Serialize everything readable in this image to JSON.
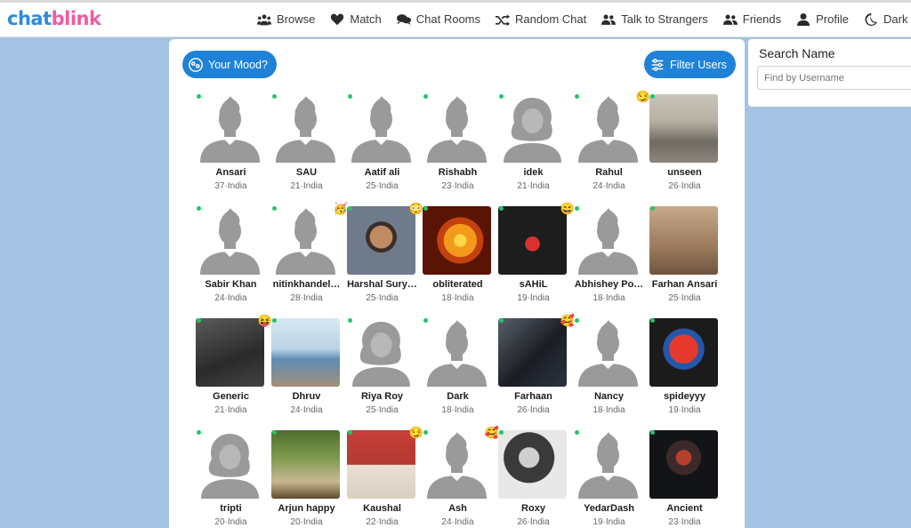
{
  "brand": {
    "part1": "chat",
    "part2": "blink"
  },
  "nav": [
    {
      "label": "Browse",
      "icon": "users-icon"
    },
    {
      "label": "Match",
      "icon": "heart-icon"
    },
    {
      "label": "Chat Rooms",
      "icon": "chat-bubbles-icon"
    },
    {
      "label": "Random Chat",
      "icon": "shuffle-icon"
    },
    {
      "label": "Talk to Strangers",
      "icon": "user-group-icon"
    },
    {
      "label": "Friends",
      "icon": "friends-icon"
    },
    {
      "label": "Profile",
      "icon": "user-icon"
    },
    {
      "label": "Dark",
      "icon": "moon-icon"
    }
  ],
  "toolbar": {
    "mood_label": "Your Mood?",
    "filter_label": "Filter Users"
  },
  "search": {
    "title": "Search Name",
    "placeholder": "Find by Username"
  },
  "colors": {
    "accent": "#1f82d8",
    "brand_blue": "#2d8be0",
    "brand_pink": "#f25aa3",
    "online": "#21c76a",
    "background": "#a5c4e4"
  },
  "users": [
    {
      "name": "Ansari",
      "meta": "37·India",
      "avatar": "male",
      "online": true,
      "emoji": ""
    },
    {
      "name": "SAU",
      "meta": "21·India",
      "avatar": "male",
      "online": true,
      "emoji": ""
    },
    {
      "name": "Aatif ali",
      "meta": "25·India",
      "avatar": "male",
      "online": true,
      "emoji": ""
    },
    {
      "name": "Rishabh",
      "meta": "23·India",
      "avatar": "male",
      "online": true,
      "emoji": ""
    },
    {
      "name": "idek",
      "meta": "21·India",
      "avatar": "female",
      "online": true,
      "emoji": ""
    },
    {
      "name": "Rahul",
      "meta": "24·India",
      "avatar": "male",
      "online": true,
      "emoji": "😏"
    },
    {
      "name": "unseen",
      "meta": "26·India",
      "avatar": "photo",
      "photo": "street",
      "online": true,
      "emoji": ""
    },
    {
      "name": "Sabir Khan",
      "meta": "24·India",
      "avatar": "male",
      "online": true,
      "emoji": ""
    },
    {
      "name": "nitinkhandel…",
      "meta": "28·India",
      "avatar": "male",
      "online": true,
      "emoji": "🥳"
    },
    {
      "name": "Harshal Sury…",
      "meta": "25·India",
      "avatar": "photo",
      "photo": "selfie",
      "online": true,
      "emoji": "😳"
    },
    {
      "name": "obliterated",
      "meta": "18·India",
      "avatar": "photo",
      "photo": "sun",
      "online": true,
      "emoji": ""
    },
    {
      "name": "sAHiL",
      "meta": "19·India",
      "avatar": "photo",
      "photo": "bow",
      "online": true,
      "emoji": "😄"
    },
    {
      "name": "Abhishey Po…",
      "meta": "18·India",
      "avatar": "male",
      "online": true,
      "emoji": ""
    },
    {
      "name": "Farhan Ansari",
      "meta": "25·India",
      "avatar": "photo",
      "photo": "standing",
      "online": true,
      "emoji": ""
    },
    {
      "name": "Generic",
      "meta": "21·India",
      "avatar": "photo",
      "photo": "vintage",
      "online": true,
      "emoji": "😝"
    },
    {
      "name": "Dhruv",
      "meta": "24·India",
      "avatar": "photo",
      "photo": "beach",
      "online": true,
      "emoji": ""
    },
    {
      "name": "Riya Roy",
      "meta": "25·India",
      "avatar": "female",
      "online": true,
      "emoji": ""
    },
    {
      "name": "Dark",
      "meta": "18·India",
      "avatar": "male",
      "online": true,
      "emoji": ""
    },
    {
      "name": "Farhaan",
      "meta": "26·India",
      "avatar": "photo",
      "photo": "dark-selfie",
      "online": true,
      "emoji": "🥰"
    },
    {
      "name": "Nancy",
      "meta": "18·India",
      "avatar": "male",
      "online": true,
      "emoji": ""
    },
    {
      "name": "spideyyy",
      "meta": "19·India",
      "avatar": "photo",
      "photo": "spider",
      "online": true,
      "emoji": ""
    },
    {
      "name": "tripti",
      "meta": "20·India",
      "avatar": "female",
      "online": true,
      "emoji": ""
    },
    {
      "name": "Arjun happy",
      "meta": "20·India",
      "avatar": "photo",
      "photo": "garden",
      "online": true,
      "emoji": ""
    },
    {
      "name": "Kaushal",
      "meta": "22·India",
      "avatar": "photo",
      "photo": "red-wall",
      "online": true,
      "emoji": "😏"
    },
    {
      "name": "Ash",
      "meta": "24·India",
      "avatar": "male",
      "online": true,
      "emoji": "🥰"
    },
    {
      "name": "Roxy",
      "meta": "26·India",
      "avatar": "photo",
      "photo": "bw-portrait",
      "online": true,
      "emoji": ""
    },
    {
      "name": "YedarDash",
      "meta": "19·India",
      "avatar": "male",
      "online": true,
      "emoji": ""
    },
    {
      "name": "Ancient",
      "meta": "23·India",
      "avatar": "photo",
      "photo": "warrior",
      "online": true,
      "emoji": ""
    }
  ]
}
